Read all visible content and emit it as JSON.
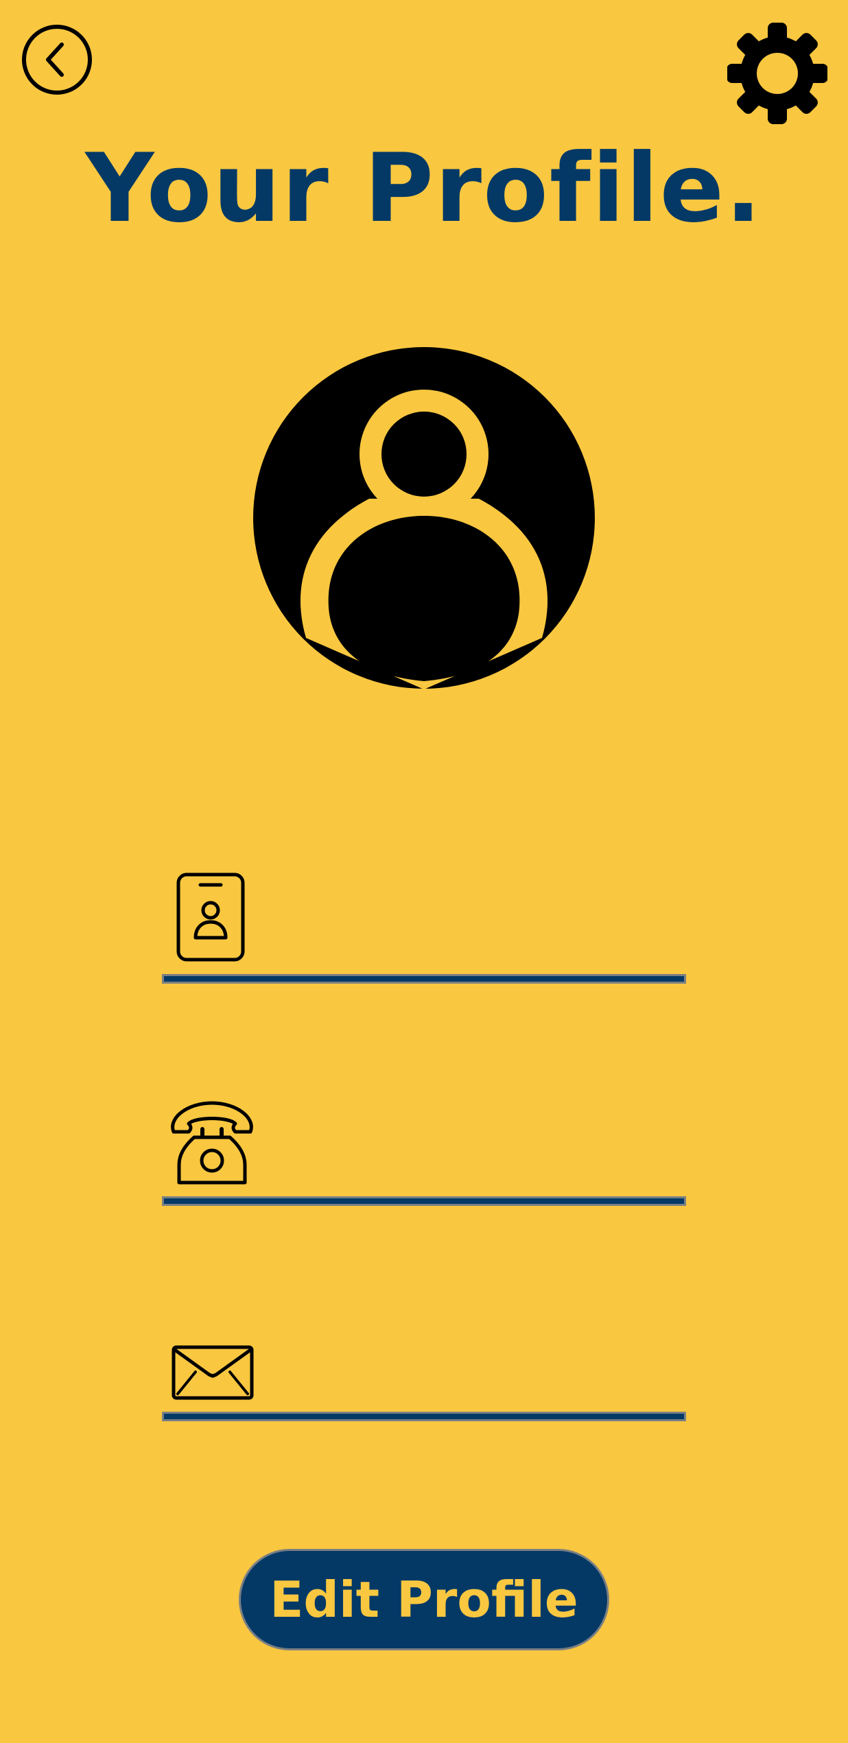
{
  "header": {
    "back_icon": "chevron-left-circle-icon",
    "settings_icon": "gear-icon",
    "title": "Your Profile."
  },
  "avatar": {
    "icon": "user-circle-icon"
  },
  "fields": {
    "name": {
      "icon": "id-badge-icon",
      "value": "",
      "placeholder": ""
    },
    "phone": {
      "icon": "telephone-icon",
      "value": "",
      "placeholder": ""
    },
    "email": {
      "icon": "envelope-icon",
      "value": "",
      "placeholder": ""
    }
  },
  "actions": {
    "edit_label": "Edit Profile"
  },
  "colors": {
    "background": "#F9C740",
    "primary": "#043966",
    "button_text": "#F9C740"
  }
}
